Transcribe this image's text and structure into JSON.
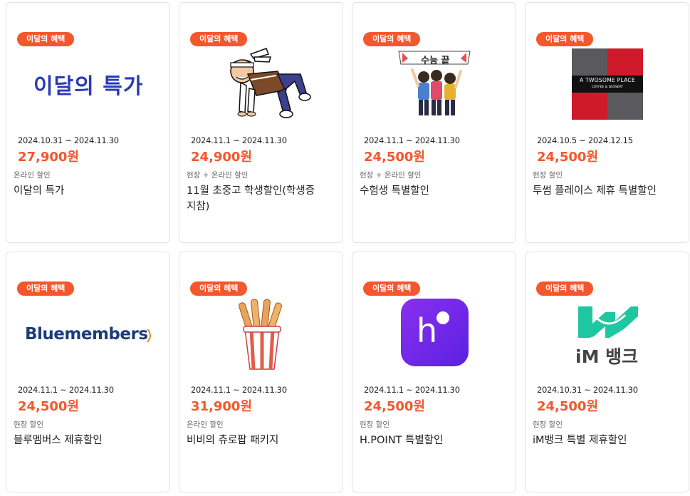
{
  "cards": [
    {
      "badge": "이달의 혜택",
      "logo_text": "이달의 특가",
      "date": "2024.10.31 ~ 2024.11.30",
      "price": "27,900원",
      "type": "온라인 할인",
      "title": "이달의 특가"
    },
    {
      "badge": "이달의 혜택",
      "date": "2024.11.1 ~ 2024.11.30",
      "price": "24,900원",
      "type": "현장 + 온라인 할인",
      "title": "11월 초중고 학생할인(학생증 지참)"
    },
    {
      "badge": "이달의 혜택",
      "banner_text": "수능 끝",
      "date": "2024.11.1 ~ 2024.11.30",
      "price": "24,500원",
      "type": "현장 + 온라인 할인",
      "title": "수험생 특별할인"
    },
    {
      "badge": "이달의 혜택",
      "logo_line1": "A TWOSOME PLACE",
      "logo_line2": "COFFEE & DESSERT",
      "date": "2024.10.5 ~ 2024.12.15",
      "price": "24,500원",
      "type": "현장 할인",
      "title": "투썸 플레이스 제휴 특별할인"
    },
    {
      "badge": "이달의 혜택",
      "logo_text": "Bluemembers",
      "date": "2024.11.1 ~ 2024.11.30",
      "price": "24,500원",
      "type": "현장 할인",
      "title": "블루멤버스 제휴할인"
    },
    {
      "badge": "이달의 혜택",
      "date": "2024.11.1 ~ 2024.11.30",
      "price": "31,900원",
      "type": "온라인 할인",
      "title": "비비의 츄로팝 패키지"
    },
    {
      "badge": "이달의 혜택",
      "logo_text": "h",
      "date": "2024.11.1 ~ 2024.11.30",
      "price": "24,500원",
      "type": "현장 할인",
      "title": "H.POINT 특별할인"
    },
    {
      "badge": "이달의 혜택",
      "logo_text": "iM 뱅크",
      "date": "2024.10.31 ~ 2024.11.30",
      "price": "24,500원",
      "type": "현장 할인",
      "title": "iM뱅크 특별 제휴할인"
    }
  ],
  "colors": {
    "accent": "#f4572d",
    "month_logo": "#2a3bb5",
    "bluemembers": "#1b3c7a",
    "hpoint": "#7b2af0",
    "im_green": "#1fc7a0"
  }
}
